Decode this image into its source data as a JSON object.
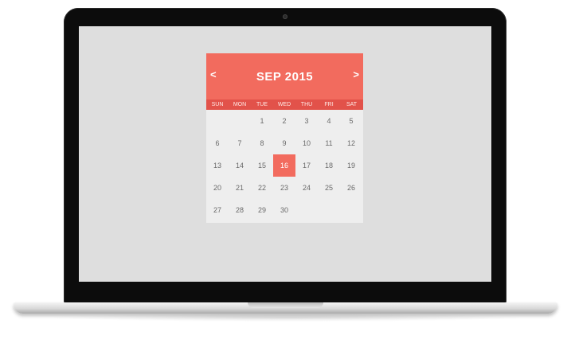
{
  "calendar": {
    "title": "SEP 2015",
    "prev_label": "<",
    "next_label": ">",
    "accent_color": "#f26b5e",
    "weekdays": [
      "SUN",
      "MON",
      "TUE",
      "WED",
      "THU",
      "FRI",
      "SAT"
    ],
    "weeks": [
      [
        "",
        "",
        "1",
        "2",
        "3",
        "4",
        "5"
      ],
      [
        "6",
        "7",
        "8",
        "9",
        "10",
        "11",
        "12"
      ],
      [
        "13",
        "14",
        "15",
        "16",
        "17",
        "18",
        "19"
      ],
      [
        "20",
        "21",
        "22",
        "23",
        "24",
        "25",
        "26"
      ],
      [
        "27",
        "28",
        "29",
        "30",
        "",
        "",
        ""
      ]
    ],
    "selected_day": "16"
  }
}
